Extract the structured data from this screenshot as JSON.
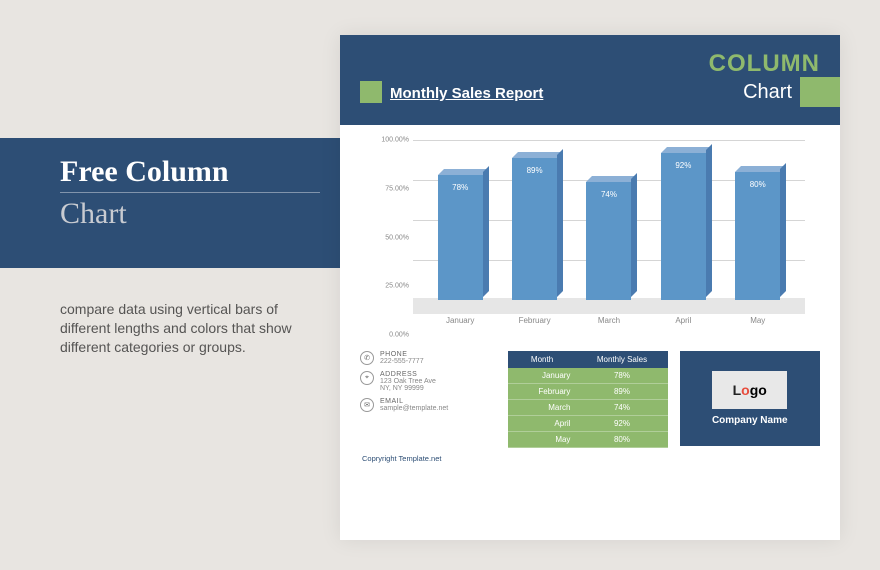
{
  "left": {
    "title1": "Free Column",
    "title2": "Chart",
    "desc": "compare data using vertical bars of different lengths and colors that show different categories or groups."
  },
  "header": {
    "title": "Monthly Sales Report",
    "word1": "COLUMN",
    "word2": "Chart"
  },
  "chart_data": {
    "type": "bar",
    "categories": [
      "January",
      "February",
      "March",
      "April",
      "May"
    ],
    "values": [
      78,
      89,
      74,
      92,
      80
    ],
    "value_labels": [
      "78%",
      "89%",
      "74%",
      "92%",
      "80%"
    ],
    "yticks": [
      "0.00%",
      "25.00%",
      "50.00%",
      "75.00%",
      "100.00%"
    ],
    "ylim": [
      0,
      100
    ]
  },
  "table": {
    "col1": "Month",
    "col2": "Monthly Sales",
    "rows": [
      {
        "m": "January",
        "v": "78%"
      },
      {
        "m": "February",
        "v": "89%"
      },
      {
        "m": "March",
        "v": "74%"
      },
      {
        "m": "April",
        "v": "92%"
      },
      {
        "m": "May",
        "v": "80%"
      }
    ]
  },
  "contact": {
    "phone_h": "PHONE",
    "phone": "222-555-7777",
    "addr_h": "ADDRESS",
    "addr1": "123 Oak Tree Ave",
    "addr2": "NY, NY 99999",
    "email_h": "EMAIL",
    "email": "sample@template.net"
  },
  "logo": {
    "l": "L",
    "o": "o",
    "go": "go",
    "company": "Company Name"
  },
  "copyright": "Copryright Template.net"
}
